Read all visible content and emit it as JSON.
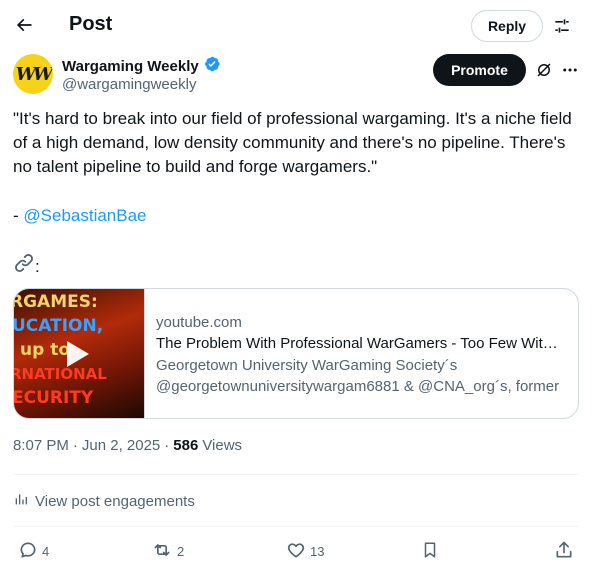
{
  "header": {
    "title": "Post",
    "reply_label": "Reply"
  },
  "author": {
    "avatar_text": "WW",
    "display_name": "Wargaming Weekly",
    "handle": "@wargamingweekly",
    "verified_icon": "verified-badge-icon"
  },
  "actions_top": {
    "promote_label": "Promote"
  },
  "post": {
    "text": "\"It's hard to break into our field of professional wargaming. It's a niche field of a high demand, low density community and there's no pipeline. There's no talent pipeline to build and forge wargamers.\"",
    "mention_prefix": "- ",
    "mention": "@SebastianBae",
    "link_suffix": ":"
  },
  "card": {
    "thumb_lines": [
      "RGAMES:",
      "UCATION,",
      "up to",
      "RNATIONAL",
      "ECURITY"
    ],
    "domain": "youtube.com",
    "title": "The Problem With Professional WarGamers - Too Few With Expertise",
    "desc_line1": "Georgetown University WarGaming Society´s",
    "desc_line2": "@georgetownuniversitywargam6881 & @CNA_org´s, former"
  },
  "meta": {
    "time": "8:07 PM",
    "sep1": "·",
    "date": "Jun 2, 2025",
    "sep2": "·",
    "views_count": "586",
    "views_label": "Views"
  },
  "engagements_label": "View post engagements",
  "stats": {
    "replies": "4",
    "reposts": "2",
    "likes": "13"
  },
  "colors": {
    "accent": "#1d9bf0",
    "text": "#0f1419",
    "secondary": "#536471",
    "avatar_bg": "#f6d21b"
  }
}
